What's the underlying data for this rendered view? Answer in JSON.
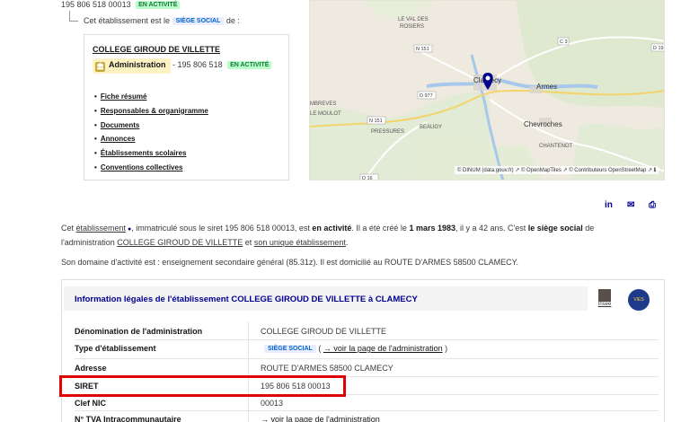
{
  "top": {
    "siret": "195 806 518 00013",
    "status_badge": "EN ACTIVITÉ",
    "est_prefix": "Cet établissement est le",
    "est_badge": "SIÈGE SOCIAL",
    "est_suffix": "de :"
  },
  "admin_card": {
    "title": "COLLEGE GIROUD DE VILLETTE",
    "tag": "Administration",
    "siren": "- 195 806 518",
    "status_badge": "EN ACTIVITÉ",
    "links": [
      "Fiche résumé",
      "Responsables & organigramme",
      "Documents",
      "Annonces",
      "Établissements scolaires",
      "Conventions collectives"
    ]
  },
  "map": {
    "places": [
      "LE VAL DES ROSIERS",
      "Clamecy",
      "Armes",
      "Chevroches",
      "CHANTENOT",
      "BEAUGY",
      "PRESSURES",
      "MBREVES",
      "LE MOULOT"
    ],
    "roads": [
      "N 151",
      "D 977",
      "N 151",
      "D 19",
      "C 3",
      "D 16"
    ],
    "attribution": "© DINUM (data.gouv.fr) ↗ © OpenMapTiles ↗ © Contributeurs OpenStreetMap ↗",
    "info_icon": "ℹ"
  },
  "share": {
    "linkedin": "in",
    "mail": "✉",
    "print": "⎙"
  },
  "para1": {
    "t1": "Cet ",
    "etab": "établissement",
    "t2": ", immatriculé sous le siret 195 806 518 00013, est ",
    "active": "en activité",
    "t3": ". Il a été créé le ",
    "date": "1 mars 1983",
    "t4": ", il y a 42 ans. C'est ",
    "siege": "le siège social",
    "t5": " de",
    "t6": "l'administration ",
    "admin": "COLLEGE GIROUD DE VILLETTE",
    "t7": " et ",
    "unique": "son unique établissement",
    "t8": "."
  },
  "para2": "Son domaine d'activité est : enseignement secondaire général (85.31z). Il est domicilié au ROUTE D'ARMES 58500 CLAMECY.",
  "legal": {
    "title": "Information légales de l'établissement COLLEGE GIROUD DE VILLETTE à CLAMECY",
    "insee_label": "Insee",
    "eu_label": "VIES",
    "rows": {
      "denomination": {
        "label": "Dénomination de l'administration",
        "value": "COLLEGE GIROUD DE VILLETTE"
      },
      "type": {
        "label": "Type d'établissement",
        "badge": "SIÈGE SOCIAL",
        "open": "( ",
        "link": "→ voir la page de l'administration",
        "close": " )"
      },
      "adresse": {
        "label": "Adresse",
        "value": "ROUTE D'ARMES 58500 CLAMECY"
      },
      "siret": {
        "label": "SIRET",
        "value": "195 806 518 00013"
      },
      "nic": {
        "label": "Clef NIC",
        "value": "00013"
      },
      "tva": {
        "label": "N° TVA Intracommunautaire",
        "link": "→ voir la page de l'administration"
      }
    }
  }
}
